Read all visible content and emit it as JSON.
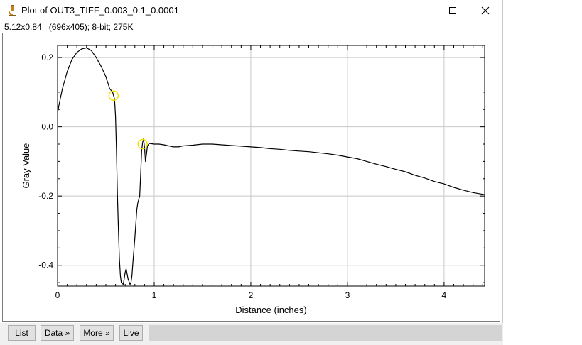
{
  "window": {
    "title": "Plot of OUT3_TIFF_0.003_0.1_0.0001",
    "subtitle": "5.12x0.84   (696x405); 8-bit; 275K",
    "icon": "microscope-icon"
  },
  "buttons": {
    "list": "List",
    "data": "Data »",
    "more": "More »",
    "live": "Live"
  },
  "colors": {
    "curve": "#000000",
    "grid": "#c8c8c8",
    "marker": "#f0e000"
  },
  "chart_data": {
    "type": "line",
    "xlabel": "Distance (inches)",
    "ylabel": "Gray Value",
    "xlim": [
      0,
      4.42
    ],
    "ylim": [
      -0.46,
      0.235
    ],
    "x_ticks": [
      0,
      1,
      2,
      3,
      4
    ],
    "x_tick_labels": [
      "0",
      "1",
      "2",
      "3",
      "4"
    ],
    "y_ticks": [
      0.2,
      0.0,
      -0.2,
      -0.4
    ],
    "y_tick_labels": [
      "0.2",
      "0.0",
      "-0.2",
      "-0.4"
    ],
    "grid": true,
    "series": [
      {
        "x": [
          0,
          0.02,
          0.05,
          0.1,
          0.15,
          0.2,
          0.25,
          0.3,
          0.35,
          0.4,
          0.45,
          0.5,
          0.54,
          0.57,
          0.59,
          0.6,
          0.61,
          0.62,
          0.63,
          0.64,
          0.65,
          0.66,
          0.68,
          0.7,
          0.71,
          0.73,
          0.75,
          0.76,
          0.77,
          0.78,
          0.8,
          0.82,
          0.83,
          0.84,
          0.85,
          0.86,
          0.87,
          0.88,
          0.89,
          0.9,
          0.91,
          0.92,
          0.93,
          0.95,
          1.0,
          1.05,
          1.1,
          1.15,
          1.2,
          1.25,
          1.3,
          1.4,
          1.5,
          1.6,
          1.7,
          1.8,
          1.9,
          2.0,
          2.1,
          2.2,
          2.3,
          2.4,
          2.5,
          2.6,
          2.7,
          2.8,
          2.9,
          3.0,
          3.1,
          3.2,
          3.3,
          3.4,
          3.5,
          3.6,
          3.7,
          3.8,
          3.9,
          4.0,
          4.1,
          4.2,
          4.3,
          4.42
        ],
        "y": [
          0.04,
          0.07,
          0.11,
          0.16,
          0.195,
          0.215,
          0.225,
          0.228,
          0.22,
          0.2,
          0.175,
          0.145,
          0.11,
          0.1,
          0.08,
          0.03,
          -0.07,
          -0.2,
          -0.3,
          -0.38,
          -0.43,
          -0.45,
          -0.455,
          -0.42,
          -0.41,
          -0.44,
          -0.455,
          -0.45,
          -0.43,
          -0.39,
          -0.32,
          -0.24,
          -0.22,
          -0.21,
          -0.2,
          -0.14,
          -0.07,
          -0.045,
          -0.035,
          -0.06,
          -0.1,
          -0.08,
          -0.055,
          -0.048,
          -0.05,
          -0.05,
          -0.052,
          -0.055,
          -0.058,
          -0.058,
          -0.055,
          -0.053,
          -0.05,
          -0.05,
          -0.052,
          -0.054,
          -0.056,
          -0.058,
          -0.06,
          -0.063,
          -0.065,
          -0.068,
          -0.07,
          -0.072,
          -0.075,
          -0.078,
          -0.082,
          -0.087,
          -0.092,
          -0.1,
          -0.108,
          -0.115,
          -0.123,
          -0.13,
          -0.14,
          -0.148,
          -0.158,
          -0.165,
          -0.175,
          -0.183,
          -0.19,
          -0.196
        ]
      }
    ],
    "markers": [
      {
        "x": 0.58,
        "y": 0.09
      },
      {
        "x": 0.88,
        "y": -0.05
      }
    ]
  }
}
